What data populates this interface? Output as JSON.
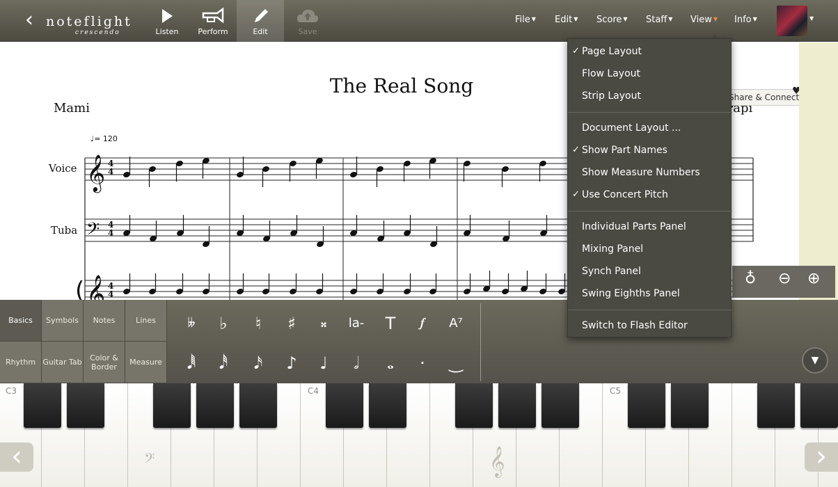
{
  "app": {
    "logo_name": "noteflight",
    "logo_sub": "crescendo"
  },
  "toolbar": {
    "buttons": [
      {
        "label": "Listen",
        "icon": "play-icon"
      },
      {
        "label": "Perform",
        "icon": "trumpet-icon"
      },
      {
        "label": "Edit",
        "icon": "pencil-icon",
        "active": true
      },
      {
        "label": "Save",
        "icon": "cloud-upload-icon",
        "disabled": true
      }
    ],
    "menus": [
      "File",
      "Edit",
      "Score",
      "Staff",
      "View",
      "Info"
    ],
    "active_menu": "View"
  },
  "score": {
    "title": "The Real Song",
    "composer_left": "Mami",
    "composer_right": "Papi",
    "tempo": "= 120",
    "parts": [
      "Voice",
      "Tuba"
    ],
    "time_signature": "4/4",
    "share_label": "Share & Connect"
  },
  "view_menu": {
    "items": [
      {
        "label": "Page Layout",
        "checked": true
      },
      {
        "label": "Flow Layout",
        "checked": false
      },
      {
        "label": "Strip Layout",
        "checked": false
      },
      {
        "sep": true
      },
      {
        "label": "Document Layout ...",
        "checked": false
      },
      {
        "label": "Show Part Names",
        "checked": true
      },
      {
        "label": "Show Measure Numbers",
        "checked": false
      },
      {
        "label": "Use Concert Pitch",
        "checked": true
      },
      {
        "sep": true
      },
      {
        "label": "Individual Parts Panel",
        "checked": false
      },
      {
        "label": "Mixing Panel",
        "checked": false
      },
      {
        "label": "Synch Panel",
        "checked": false
      },
      {
        "label": "Swing Eighths Panel",
        "checked": false
      },
      {
        "sep": true
      },
      {
        "label": "Switch to Flash Editor",
        "checked": false
      }
    ]
  },
  "palette": {
    "tabs": [
      {
        "label": "Basics",
        "active": true
      },
      {
        "label": "Symbols"
      },
      {
        "label": "Notes"
      },
      {
        "label": "Lines"
      },
      {
        "label": "Rhythm"
      },
      {
        "label": "Guitar Tab"
      },
      {
        "label": "Color & Border"
      },
      {
        "label": "Measure"
      }
    ],
    "tools_row1": [
      {
        "glyph": "𝄫",
        "name": "double-flat-tool"
      },
      {
        "glyph": "♭",
        "name": "flat-tool"
      },
      {
        "glyph": "♮",
        "name": "natural-tool"
      },
      {
        "glyph": "♯",
        "name": "sharp-tool"
      },
      {
        "glyph": "𝄪",
        "name": "double-sharp-tool"
      },
      {
        "glyph": "la-",
        "name": "lyric-tool"
      },
      {
        "glyph": "T",
        "name": "text-tool"
      },
      {
        "glyph": "𝆑",
        "name": "dynamic-forte-tool"
      },
      {
        "glyph": "A⁷",
        "name": "chord-symbol-tool"
      }
    ],
    "tools_row2": [
      {
        "glyph": "𝅘𝅥𝅱",
        "name": "sixty-fourth-note-tool"
      },
      {
        "glyph": "𝅘𝅥𝅰",
        "name": "thirty-second-note-tool"
      },
      {
        "glyph": "𝅘𝅥𝅯",
        "name": "sixteenth-note-tool"
      },
      {
        "glyph": "♪",
        "name": "eighth-note-tool"
      },
      {
        "glyph": "♩",
        "name": "quarter-note-tool"
      },
      {
        "glyph": "𝅗𝅥",
        "name": "half-note-tool"
      },
      {
        "glyph": "𝅝",
        "name": "whole-note-tool"
      },
      {
        "glyph": "·",
        "name": "dot-tool"
      },
      {
        "glyph": "‿",
        "name": "tie-tool"
      }
    ]
  },
  "keyboard": {
    "labels": [
      "C3",
      "C4",
      "C5"
    ]
  }
}
